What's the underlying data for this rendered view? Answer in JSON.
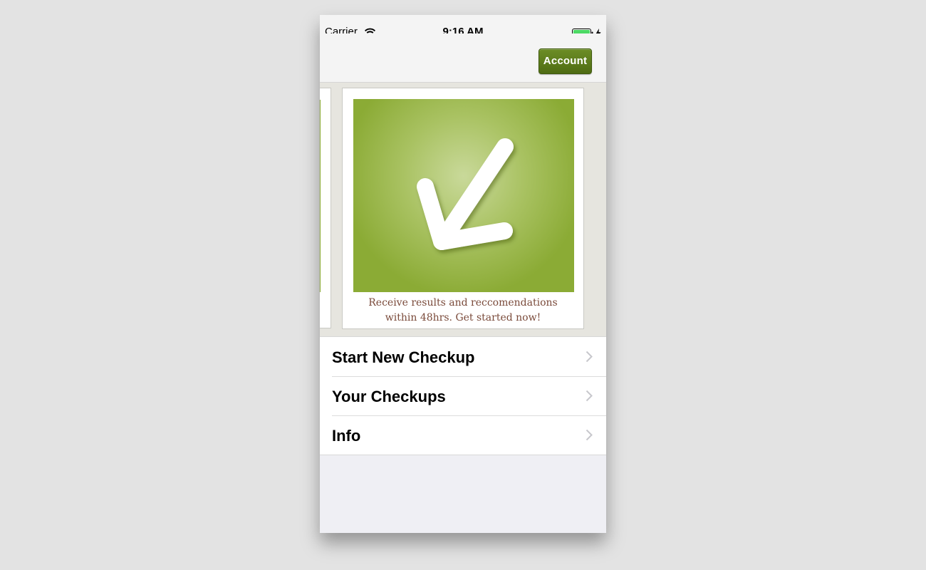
{
  "status_bar": {
    "carrier": "Carrier",
    "time": "9:16 AM",
    "wifi_icon": "wifi-icon",
    "battery_icon": "battery-icon",
    "charging_icon": "bolt-icon"
  },
  "nav_bar": {
    "account_label": "Account"
  },
  "carousel": {
    "current_card": {
      "icon": "checkmark-icon",
      "caption_line1": "Receive results and reccomendations",
      "caption_line2": "within 48hrs. Get started now!"
    }
  },
  "menu": {
    "items": [
      {
        "label": "Start New Checkup",
        "icon": "chevron-right-icon"
      },
      {
        "label": "Your Checkups",
        "icon": "chevron-right-icon"
      },
      {
        "label": "Info",
        "icon": "chevron-right-icon"
      }
    ]
  },
  "colors": {
    "accent_green": "#8bab35",
    "button_green": "#5b7a1b",
    "caption_brown": "#7a4a3a",
    "battery_green": "#4cd964"
  }
}
